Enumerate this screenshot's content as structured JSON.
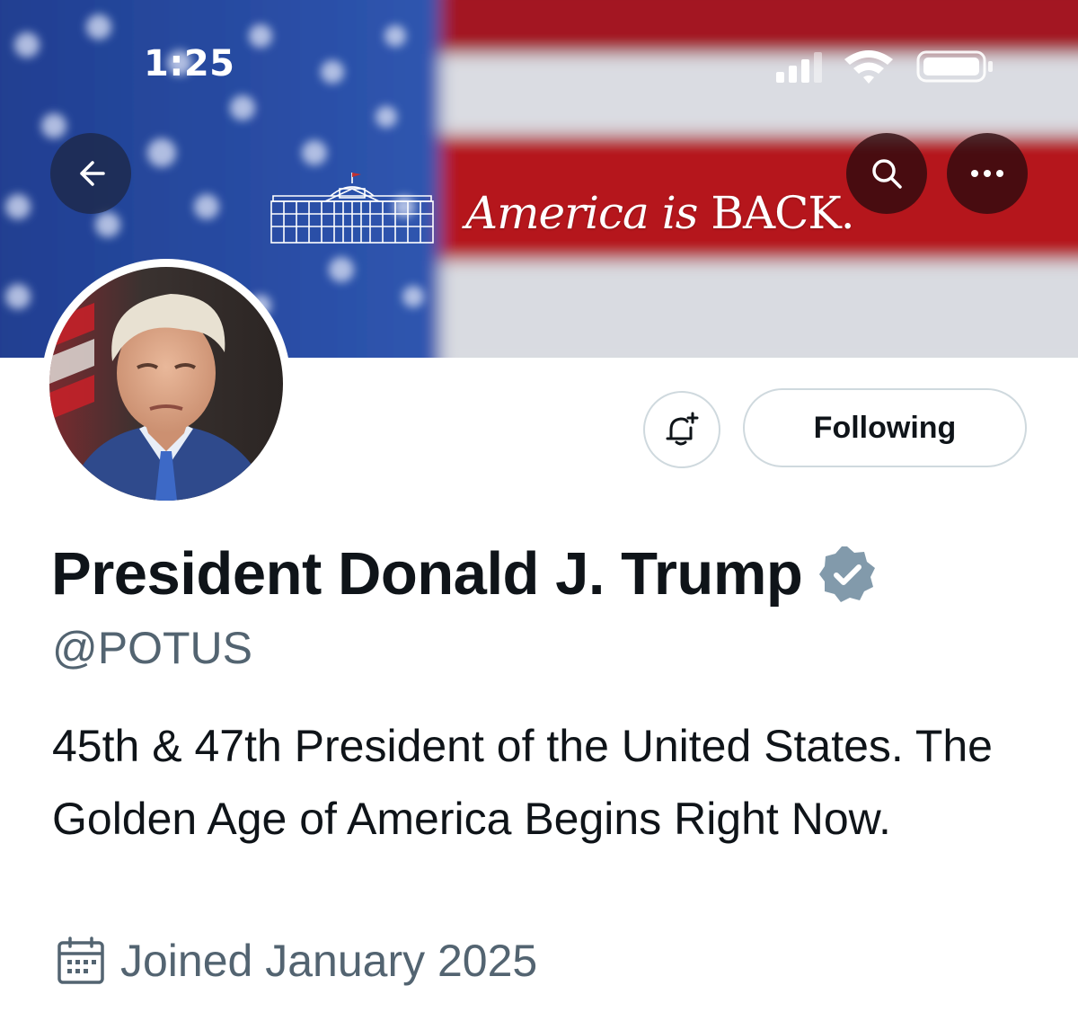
{
  "status_bar": {
    "time": "1:25",
    "icons": [
      "signal-icon",
      "wifi-icon",
      "battery-icon"
    ]
  },
  "header": {
    "back_icon": "back-arrow-icon",
    "search_icon": "search-icon",
    "more_icon": "more-icon"
  },
  "banner": {
    "text_italic": "America is ",
    "text_caps": "BACK."
  },
  "profile": {
    "display_name": "President Donald J. Trump",
    "handle": "@POTUS",
    "bio": "45th & 47th President of the United States. The Golden Age of America Begins Right Now.",
    "joined": "Joined January 2025",
    "verified_color": "#829aab"
  },
  "actions": {
    "following_label": "Following",
    "notify_icon": "bell-plus-icon"
  },
  "colors": {
    "text_primary": "#0f1419",
    "text_secondary": "#536471",
    "border": "#cfd9de",
    "flag_blue": "#2c4a9e",
    "flag_red": "#b11a24"
  }
}
